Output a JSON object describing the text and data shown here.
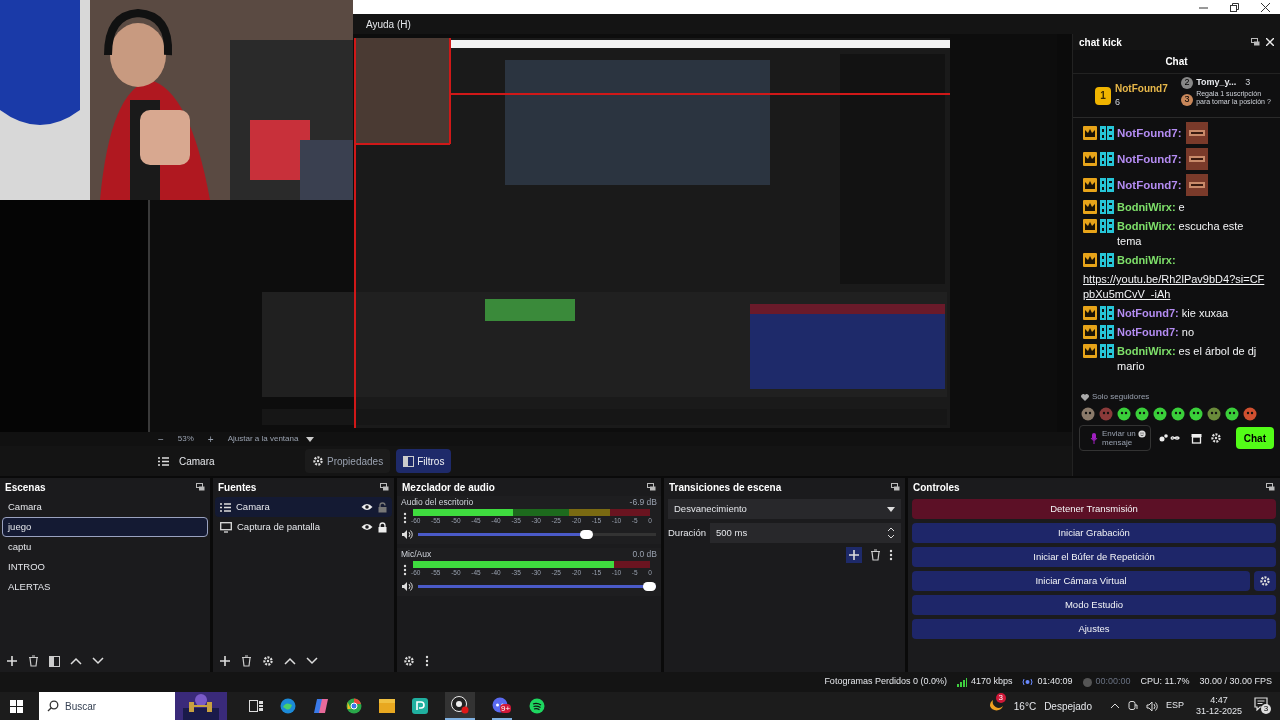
{
  "menu": [
    "Ayuda (H)"
  ],
  "preview": {
    "zoom_out": "−",
    "zoom": "53%",
    "zoom_in": "+",
    "fit": "Ajustar a la ventana"
  },
  "source_toolbar": {
    "source": "Camara",
    "tabs": [
      {
        "label": "Propiedades",
        "selected": false
      },
      {
        "label": "Filtros",
        "selected": true
      }
    ]
  },
  "chat": {
    "dock_title": "chat kick",
    "header": "Chat",
    "leaders": [
      {
        "rank": "1",
        "name": "NotFound7",
        "count": "6"
      },
      {
        "rank": "2",
        "name": "Tomy_y...",
        "count": "3"
      }
    ],
    "gift": {
      "rank": "3",
      "text": "Regala 1 suscripción para tomar la posición ?"
    },
    "messages": [
      {
        "kind": "emote",
        "user": "NotFound7:",
        "color": "#b48cf2"
      },
      {
        "kind": "emote",
        "user": "NotFound7:",
        "color": "#b48cf2"
      },
      {
        "kind": "emote",
        "user": "NotFound7:",
        "color": "#b48cf2"
      },
      {
        "kind": "text",
        "user": "BodniWirx:",
        "color": "#7ee06a",
        "text": "e"
      },
      {
        "kind": "text",
        "user": "BodniWirx:",
        "color": "#7ee06a",
        "text": "escucha este tema"
      },
      {
        "kind": "link",
        "user": "BodniWirx:",
        "color": "#7ee06a",
        "text": "https://youtu.be/Rh2lPav9bD4?si=CFpbXu5mCvV_-iAh"
      },
      {
        "kind": "text",
        "user": "NotFound7:",
        "color": "#b48cf2",
        "text": "kie xuxaa"
      },
      {
        "kind": "text",
        "user": "NotFound7:",
        "color": "#b48cf2",
        "text": "no"
      },
      {
        "kind": "text",
        "user": "BodniWirx:",
        "color": "#7ee06a",
        "text": "es el árbol de dj mario"
      }
    ],
    "mode": "Solo seguidores",
    "input": {
      "placeholder_1": "Enviar un",
      "placeholder_2": "mensaje"
    },
    "send": "Chat"
  },
  "scenes": {
    "title": "Escenas",
    "items": [
      {
        "label": "Camara",
        "selected": false
      },
      {
        "label": "juego",
        "selected": true
      },
      {
        "label": "captu",
        "selected": false
      },
      {
        "label": "INTROO",
        "selected": false
      },
      {
        "label": "ALERTAS",
        "selected": false
      }
    ]
  },
  "sources": {
    "title": "Fuentes",
    "items": [
      {
        "kind": "group",
        "label": "Camara",
        "selected": true,
        "visible": true,
        "locked": false
      },
      {
        "kind": "display",
        "label": "Captura de pantalla",
        "selected": false,
        "visible": true,
        "locked": true
      }
    ]
  },
  "mixer": {
    "title": "Mezclador de audio",
    "channels": [
      {
        "name": "Audio del escritorio",
        "reading": "-6.9 dB",
        "level": 0.42,
        "volume": {
          "level": 0.72
        },
        "scale": [
          "-60",
          "-55",
          "-50",
          "-45",
          "-40",
          "-35",
          "-30",
          "-25",
          "-20",
          "-15",
          "-10",
          "-5",
          "0"
        ]
      },
      {
        "name": "Mic/Aux",
        "reading": "0.0 dB",
        "level": 0.85,
        "volume": {
          "level": 1
        },
        "scale": [
          "-60",
          "-55",
          "-50",
          "-45",
          "-40",
          "-35",
          "-30",
          "-25",
          "-20",
          "-15",
          "-10",
          "-5",
          "0"
        ]
      }
    ]
  },
  "transitions": {
    "title": "Transiciones de escena",
    "type": "Desvanecimiento",
    "duration_label": "Duración",
    "duration": "500 ms"
  },
  "controls": {
    "title": "Controles",
    "buttons": [
      {
        "label": "Detener Transmisión",
        "kind": "stop",
        "settings": false
      },
      {
        "label": "Iniciar Grabación",
        "kind": "start",
        "settings": false
      },
      {
        "label": "Iniciar el Búfer de Repetición",
        "kind": "start",
        "settings": false
      },
      {
        "label": "Iniciar Cámara Virtual",
        "kind": "start",
        "settings": true
      },
      {
        "label": "Modo Estudio",
        "kind": "start",
        "settings": false
      },
      {
        "label": "Ajustes",
        "kind": "start",
        "settings": false
      }
    ]
  },
  "status_bar": {
    "dropped": "Fotogramas Perdidos 0 (0.0%)",
    "bitrate": "4170 kbps",
    "stream_time": "01:40:09",
    "record_time": "00:00:00",
    "cpu": "CPU: 11.7%",
    "fps": "30.00 / 30.00 FPS"
  },
  "taskbar": {
    "search_placeholder": "Buscar",
    "app_badge": "9+",
    "weather_badge": "3",
    "temperature": "16°C",
    "weather": "Despejado",
    "language": "ESP",
    "time": "4:47",
    "date": "31-12-2025",
    "notifications": "3"
  }
}
